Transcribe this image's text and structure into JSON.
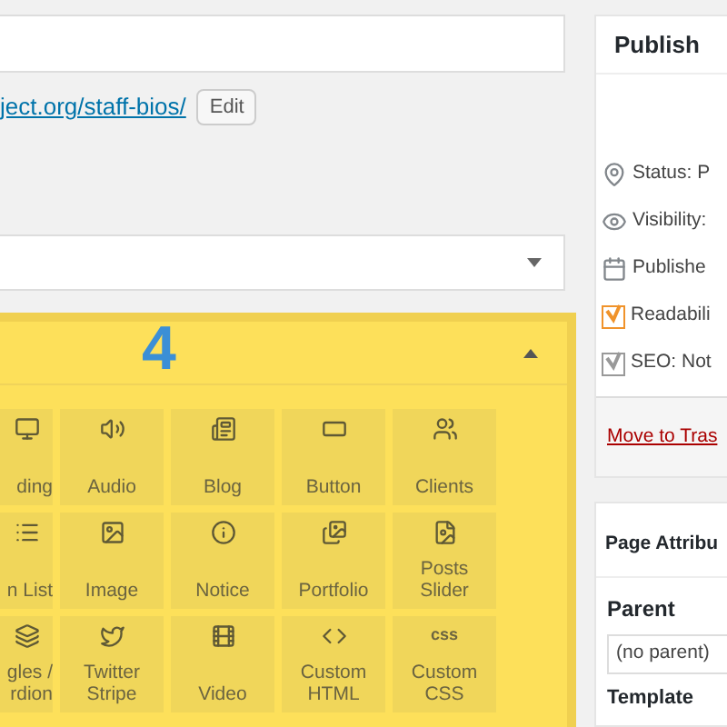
{
  "permalink": {
    "url": "ject.org/staff-bios/",
    "edit_button": "Edit"
  },
  "step_number": "4",
  "builder": {
    "expanded": true,
    "tiles": [
      {
        "kind": "heading",
        "label": "ding"
      },
      {
        "kind": "audio",
        "label": "Audio"
      },
      {
        "kind": "blog",
        "label": "Blog"
      },
      {
        "kind": "button",
        "label": "Button"
      },
      {
        "kind": "clients",
        "label": "Clients"
      },
      {
        "kind": "list",
        "label": "n List"
      },
      {
        "kind": "image",
        "label": "Image"
      },
      {
        "kind": "notice",
        "label": "Notice"
      },
      {
        "kind": "portfolio",
        "label": "Portfolio"
      },
      {
        "kind": "slider",
        "label": "Posts Slider"
      },
      {
        "kind": "toggles",
        "label": "gles / rdion"
      },
      {
        "kind": "twitter",
        "label": "Twitter Stripe"
      },
      {
        "kind": "video",
        "label": "Video"
      },
      {
        "kind": "html",
        "label": "Custom HTML"
      },
      {
        "kind": "css",
        "label": "Custom CSS",
        "icon_text": "css"
      }
    ]
  },
  "publish": {
    "title": "Publish",
    "rows": [
      {
        "kind": "status",
        "text": "Status: P"
      },
      {
        "kind": "visibility",
        "text": "Visibility:"
      },
      {
        "kind": "date",
        "text": "Publishe"
      },
      {
        "kind": "readability",
        "text": "Readabili"
      },
      {
        "kind": "seo",
        "text": "SEO: Not"
      }
    ],
    "trash_link": "Move to Tras"
  },
  "page_attributes": {
    "title": "Page Attribu",
    "parent_label": "Parent",
    "parent_value": "(no parent)",
    "template_label": "Template"
  }
}
